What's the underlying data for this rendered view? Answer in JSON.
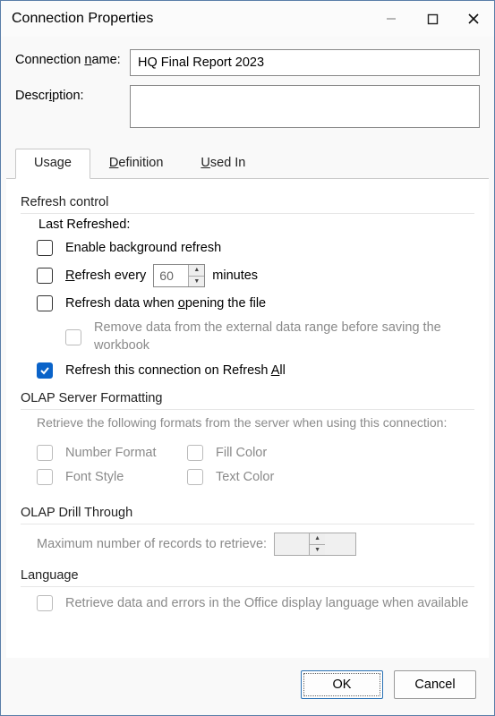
{
  "window": {
    "title": "Connection Properties"
  },
  "form": {
    "name_label_pre": "Connection ",
    "name_label_u": "n",
    "name_label_post": "ame:",
    "name_value": "HQ Final Report 2023",
    "desc_label_pre": "Descr",
    "desc_label_u": "i",
    "desc_label_post": "ption:",
    "desc_value": ""
  },
  "tabs": {
    "usage": "Usage",
    "definition_u": "D",
    "definition_post": "efinition",
    "usedin_u": "U",
    "usedin_post": "sed In"
  },
  "refresh": {
    "section": "Refresh control",
    "last_refreshed": "Last Refreshed:",
    "enable_bg_pre": "Enable back",
    "enable_bg_u": "g",
    "enable_bg_post": "round refresh",
    "refresh_every_u": "R",
    "refresh_every_post": "efresh every",
    "interval": "60",
    "minutes": "minutes",
    "on_open_pre": "Refresh data when ",
    "on_open_u": "o",
    "on_open_post": "pening the file",
    "remove_data": "Remove data from the external data range before saving the workbook",
    "refresh_all_pre": "Refresh this connection on Refresh ",
    "refresh_all_u": "A",
    "refresh_all_post": "ll"
  },
  "olap_fmt": {
    "section": "OLAP Server Formatting",
    "hint": "Retrieve the following formats from the server when using this connection:",
    "number": "Number Format",
    "fill": "Fill Color",
    "font": "Font Style",
    "text": "Text Color"
  },
  "drill": {
    "section": "OLAP Drill Through",
    "label": "Maximum number of records to retrieve:"
  },
  "lang": {
    "section": "Language",
    "label": "Retrieve data and errors in the Office display language when available"
  },
  "buttons": {
    "ok": "OK",
    "cancel": "Cancel"
  }
}
